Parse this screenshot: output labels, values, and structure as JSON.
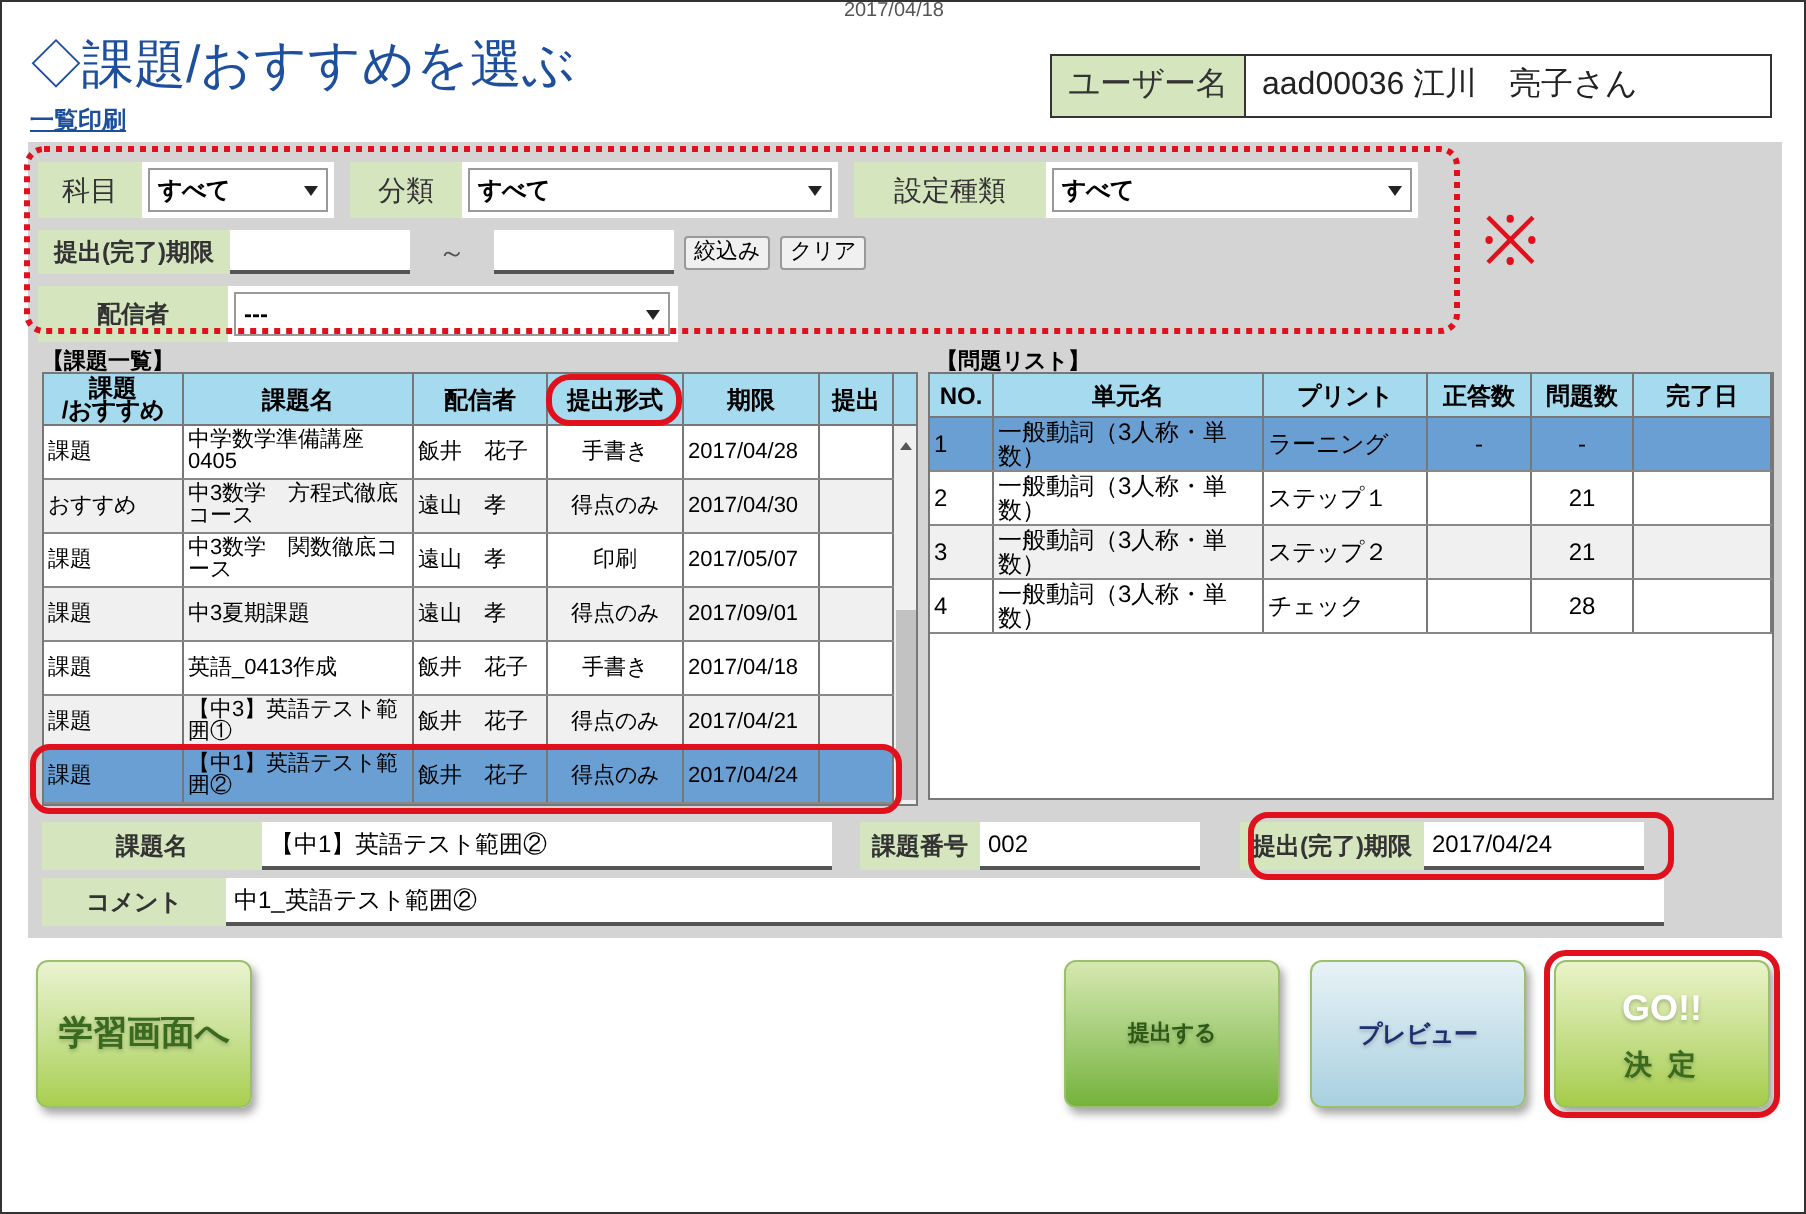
{
  "date": "2017/04/18",
  "title": "◇課題/おすすめを選ぶ",
  "user": {
    "label": "ユーザー名",
    "value": "aad00036 江川　亮子さん"
  },
  "print_link": "一覧印刷",
  "filters": {
    "annotated": true,
    "note_mark": "※",
    "selects": [
      {
        "label": "科目",
        "value": "すべて"
      },
      {
        "label": "分類",
        "value": "すべて"
      },
      {
        "label": "設定種類",
        "value": "すべて"
      }
    ],
    "deadline": {
      "label": "提出(完了)期限",
      "separator": "～"
    },
    "buttons": [
      "絞込み",
      "クリア"
    ],
    "sender": {
      "label": "配信者",
      "value": "---"
    }
  },
  "task_list": {
    "title": "【課題一覧】",
    "columns": [
      {
        "label": "課題\n/おすすめ",
        "annotated": false
      },
      {
        "label": "課題名",
        "annotated": false
      },
      {
        "label": "配信者",
        "annotated": false
      },
      {
        "label": "提出形式",
        "annotated": true
      },
      {
        "label": "期限",
        "annotated": false
      },
      {
        "label": "提出",
        "annotated": false
      }
    ],
    "rows": [
      {
        "type": "課題",
        "name": "中学数学準備講座0405",
        "sender": "飯井　花子",
        "format": "手書き",
        "deadline": "2017/04/28",
        "selected": false,
        "annotated": false
      },
      {
        "type": "おすすめ",
        "name": "中3数学　方程式徹底コース",
        "sender": "遠山　孝",
        "format": "得点のみ",
        "deadline": "2017/04/30",
        "selected": false,
        "annotated": false
      },
      {
        "type": "課題",
        "name": "中3数学　関数徹底コース",
        "sender": "遠山　孝",
        "format": "印刷",
        "deadline": "2017/05/07",
        "selected": false,
        "annotated": false
      },
      {
        "type": "課題",
        "name": "中3夏期課題",
        "sender": "遠山　孝",
        "format": "得点のみ",
        "deadline": "2017/09/01",
        "selected": false,
        "annotated": false
      },
      {
        "type": "課題",
        "name": "英語_0413作成",
        "sender": "飯井　花子",
        "format": "手書き",
        "deadline": "2017/04/18",
        "selected": false,
        "annotated": false
      },
      {
        "type": "課題",
        "name": "【中3】英語テスト範囲①",
        "sender": "飯井　花子",
        "format": "得点のみ",
        "deadline": "2017/04/21",
        "selected": false,
        "annotated": false
      },
      {
        "type": "課題",
        "name": "【中1】英語テスト範囲②",
        "sender": "飯井　花子",
        "format": "得点のみ",
        "deadline": "2017/04/24",
        "selected": true,
        "annotated": true
      }
    ]
  },
  "problem_list": {
    "title": "【問題リスト】",
    "columns": [
      "NO.",
      "単元名",
      "プリント",
      "正答数",
      "問題数",
      "完了日"
    ],
    "rows": [
      {
        "no": "1",
        "unit": "一般動詞（3人称・単数）",
        "print": "ラーニング",
        "correct": "-",
        "total": "-",
        "selected": true
      },
      {
        "no": "2",
        "unit": "一般動詞（3人称・単数）",
        "print": "ステップ１",
        "total": "21",
        "selected": false
      },
      {
        "no": "3",
        "unit": "一般動詞（3人称・単数）",
        "print": "ステップ２",
        "total": "21",
        "selected": false
      },
      {
        "no": "4",
        "unit": "一般動詞（3人称・単数）",
        "print": "チェック",
        "total": "28",
        "selected": false
      }
    ]
  },
  "details": {
    "name": {
      "label": "課題名",
      "value": "【中1】英語テスト範囲②"
    },
    "number": {
      "label": "課題番号",
      "value": "002"
    },
    "deadline": {
      "label": "提出(完了)期限",
      "value": "2017/04/24",
      "annotated": true
    },
    "comment": {
      "label": "コメント",
      "value": "中1_英語テスト範囲②"
    }
  },
  "buttons": [
    {
      "kind": "study",
      "label": "学習画面へ",
      "annotated": false
    },
    {
      "kind": "submit",
      "label": "提出する",
      "annotated": false
    },
    {
      "kind": "preview",
      "label": "プレビュー",
      "annotated": false
    },
    {
      "kind": "go",
      "label": "GO!!",
      "sublabel": "決 定",
      "annotated": true
    }
  ]
}
